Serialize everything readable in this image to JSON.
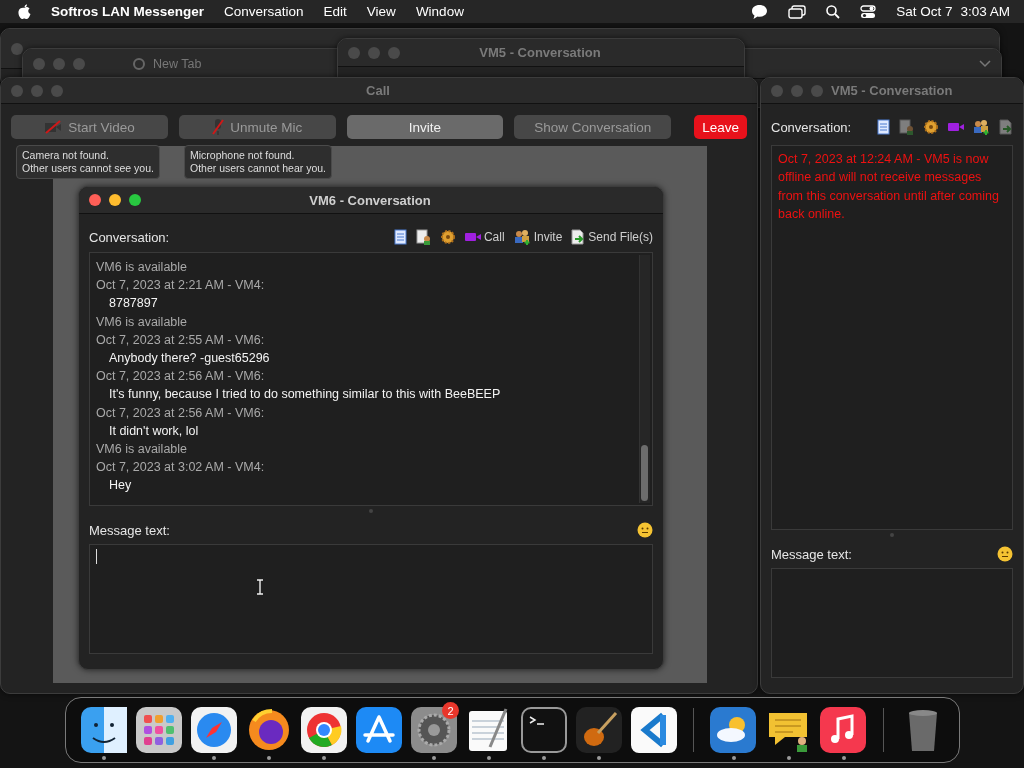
{
  "menu_bar": {
    "app": "Softros LAN Messenger",
    "menus": [
      "Conversation",
      "Edit",
      "View",
      "Window"
    ],
    "date": "Sat Oct 7",
    "time": "3:03 AM"
  },
  "background_windows": {
    "browser_tab": "New Tab",
    "conversation_title": "VM5 - Conversation"
  },
  "call_window": {
    "title": "Call",
    "active": false,
    "buttons": [
      {
        "label": "Start Video",
        "kind": "video",
        "disabled": true
      },
      {
        "label": "Unmute Mic",
        "kind": "mic",
        "disabled": true
      },
      {
        "label": "Invite",
        "kind": "plain",
        "disabled": false
      },
      {
        "label": "Show Conversation",
        "kind": "plain",
        "disabled": true
      },
      {
        "label": "Leave",
        "kind": "danger"
      }
    ],
    "tooltips": [
      "Camera not found.\nOther users cannot see you.",
      "Microphone not found.\nOther users cannot hear you."
    ]
  },
  "vm6_window": {
    "title": "VM6 - Conversation",
    "active": true,
    "conversation_label": "Conversation:",
    "tools": [
      {
        "kind": "notes",
        "disabled": false
      },
      {
        "kind": "info",
        "disabled": false
      },
      {
        "kind": "gear",
        "disabled": false
      },
      {
        "kind": "video",
        "label": "Call",
        "disabled": false
      },
      {
        "kind": "people",
        "label": "Invite",
        "disabled": false
      },
      {
        "kind": "file",
        "label": "Send File(s)",
        "disabled": false
      }
    ],
    "messages": [
      {
        "kind": "status",
        "text": "VM6 is available"
      },
      {
        "kind": "header",
        "text": "Oct 7, 2023 at 2:21 AM - VM4:"
      },
      {
        "kind": "body",
        "text": "8787897"
      },
      {
        "kind": "status",
        "text": "VM6 is available"
      },
      {
        "kind": "header",
        "text": "Oct 7, 2023 at 2:55 AM - VM6:"
      },
      {
        "kind": "body",
        "text": "Anybody there? -guest65296"
      },
      {
        "kind": "header",
        "text": "Oct 7, 2023 at 2:56 AM - VM6:"
      },
      {
        "kind": "body",
        "text": "It's funny, because I tried to do something similar to this with BeeBEEP"
      },
      {
        "kind": "header",
        "text": "Oct 7, 2023 at 2:56 AM - VM6:"
      },
      {
        "kind": "body",
        "text": "It didn't work, lol"
      },
      {
        "kind": "status",
        "text": "VM6 is available"
      },
      {
        "kind": "header",
        "text": "Oct 7, 2023 at 3:02 AM - VM4:"
      },
      {
        "kind": "body",
        "text": "Hey"
      }
    ],
    "message_label": "Message text:"
  },
  "vm5_window": {
    "title": "VM5 - Conversation",
    "active": false,
    "conversation_label": "Conversation:",
    "tools": [
      {
        "kind": "notes",
        "disabled": false
      },
      {
        "kind": "info",
        "disabled": true
      },
      {
        "kind": "gear",
        "disabled": false
      },
      {
        "kind": "video",
        "disabled": false
      },
      {
        "kind": "people",
        "disabled": false
      },
      {
        "kind": "file",
        "disabled": true
      }
    ],
    "notice": "Oct 7, 2023 at 12:24 AM - VM5 is now offline and will not receive messages from this conversation until after coming back online.",
    "message_label": "Message text:"
  },
  "dock": {
    "items": [
      {
        "kind": "finder",
        "running": true
      },
      {
        "kind": "launchpad",
        "running": false
      },
      {
        "kind": "safari",
        "running": true
      },
      {
        "kind": "firefox",
        "running": true
      },
      {
        "kind": "chrome",
        "running": true
      },
      {
        "kind": "appstore",
        "running": false
      },
      {
        "kind": "settings",
        "running": true,
        "badge": "2"
      },
      {
        "kind": "textedit",
        "running": true
      },
      {
        "kind": "terminal",
        "running": true
      },
      {
        "kind": "garageband",
        "running": true
      },
      {
        "kind": "vscode",
        "running": false
      },
      {
        "kind": "separator"
      },
      {
        "kind": "weather",
        "running": true
      },
      {
        "kind": "messenger",
        "running": true
      },
      {
        "kind": "music",
        "running": true
      },
      {
        "kind": "separator"
      },
      {
        "kind": "trash",
        "running": false
      }
    ]
  }
}
